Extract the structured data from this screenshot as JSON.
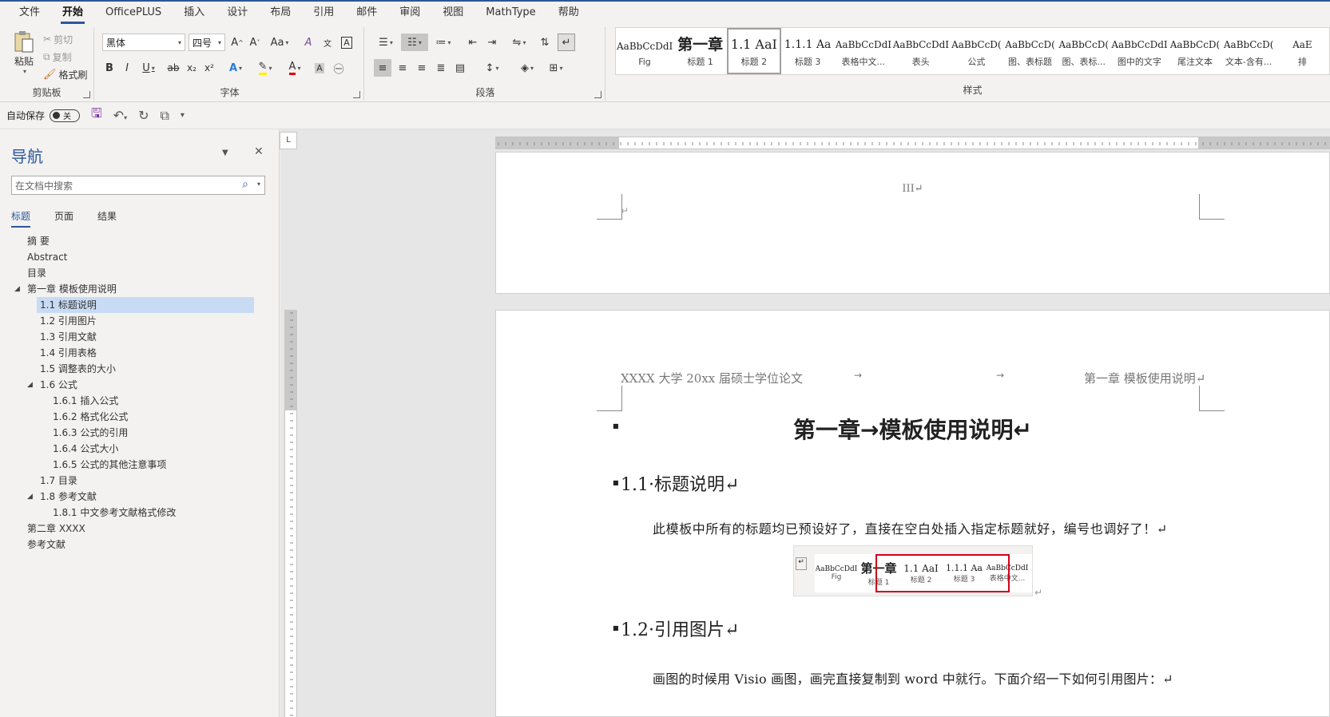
{
  "menu": {
    "tabs": [
      "文件",
      "开始",
      "OfficePLUS",
      "插入",
      "设计",
      "布局",
      "引用",
      "邮件",
      "审阅",
      "视图",
      "MathType",
      "帮助"
    ],
    "active": "开始"
  },
  "ribbon": {
    "clipboard": {
      "label": "剪贴板",
      "paste": "粘贴",
      "cut": "剪切",
      "copy": "复制",
      "format_painter": "格式刷"
    },
    "font": {
      "label": "字体",
      "font_name": "黑体",
      "font_size": "四号",
      "bold": "B",
      "italic": "I",
      "underline": "U",
      "strike": "ab",
      "sub": "x₂",
      "sup": "x²",
      "case": "Aa",
      "grow": "A^",
      "shrink": "A˅"
    },
    "paragraph": {
      "label": "段落"
    },
    "styles": {
      "label": "样式",
      "items": [
        {
          "preview": "AaBbCcDdI",
          "name": "Fig",
          "kind": "normal"
        },
        {
          "preview": "第一章",
          "name": "标题 1",
          "kind": "big"
        },
        {
          "preview": "1.1  AaI",
          "name": "标题 2",
          "kind": "mid",
          "selected": true
        },
        {
          "preview": "1.1.1  Aa",
          "name": "标题 3",
          "kind": "h3"
        },
        {
          "preview": "AaBbCcDdI",
          "name": "表格中文...",
          "kind": "normal"
        },
        {
          "preview": "AaBbCcDdI",
          "name": "表头",
          "kind": "normal"
        },
        {
          "preview": "AaBbCcD(",
          "name": "公式",
          "kind": "normal"
        },
        {
          "preview": "AaBbCcD(",
          "name": "图、表标题",
          "kind": "normal"
        },
        {
          "preview": "AaBbCcD(",
          "name": "图、表标...",
          "kind": "normal"
        },
        {
          "preview": "AaBbCcDdI",
          "name": "图中的文字",
          "kind": "normal"
        },
        {
          "preview": "AaBbCcD(",
          "name": "尾注文本",
          "kind": "normal"
        },
        {
          "preview": "AaBbCcD(",
          "name": "文本-含有...",
          "kind": "normal"
        },
        {
          "preview": "AaE",
          "name": "排",
          "kind": "normal"
        }
      ]
    }
  },
  "qat": {
    "autosave_label": "自动保存",
    "autosave_state": "关"
  },
  "nav": {
    "title": "导航",
    "search_placeholder": "在文档中搜索",
    "tabs": [
      "标题",
      "页面",
      "结果"
    ],
    "active_tab": "标题",
    "items": [
      {
        "text": "摘  要",
        "level": 0
      },
      {
        "text": "Abstract",
        "level": 0
      },
      {
        "text": "目录",
        "level": 0
      },
      {
        "text": "第一章  模板使用说明",
        "level": 0,
        "expanded": true
      },
      {
        "text": "1.1  标题说明",
        "level": 1,
        "selected": true
      },
      {
        "text": "1.2  引用图片",
        "level": 1
      },
      {
        "text": "1.3  引用文献",
        "level": 1
      },
      {
        "text": "1.4  引用表格",
        "level": 1
      },
      {
        "text": "1.5  调整表的大小",
        "level": 1
      },
      {
        "text": "1.6  公式",
        "level": 1,
        "expanded": true
      },
      {
        "text": "1.6.1  插入公式",
        "level": 2
      },
      {
        "text": "1.6.2  格式化公式",
        "level": 2
      },
      {
        "text": "1.6.3  公式的引用",
        "level": 2
      },
      {
        "text": "1.6.4  公式大小",
        "level": 2
      },
      {
        "text": "1.6.5  公式的其他注意事项",
        "level": 2
      },
      {
        "text": "1.7  目录",
        "level": 1
      },
      {
        "text": "1.8  参考文献",
        "level": 1,
        "expanded": true
      },
      {
        "text": "1.8.1  中文参考文献格式修改",
        "level": 2
      },
      {
        "text": "第二章  XXXX",
        "level": 0
      },
      {
        "text": "参考文献",
        "level": 0
      }
    ]
  },
  "document": {
    "page1_number": "III↵",
    "header_left": "XXXX 大学 20xx 届硕士学位论文",
    "header_right": "第一章 模板使用说明↵",
    "chapter_title": "第一章→模板使用说明↵",
    "h2_1": "1.1·标题说明↵",
    "para_1": "此模板中所有的标题均已预设好了，直接在空白处插入指定标题就好，编号也调好了！↵",
    "h2_2": "1.2·引用图片↵",
    "para_2": "画图的时候用 Visio 画图，画完直接复制到 word 中就行。下面介绍一下如何引用图片：↵",
    "inline_styles": [
      {
        "preview": "AaBbCcDdI",
        "name": "Fig"
      },
      {
        "preview": "第一章",
        "name": "标题 1"
      },
      {
        "preview": "1.1  AaI",
        "name": "标题 2"
      },
      {
        "preview": "1.1.1  Aa",
        "name": "标题 3"
      },
      {
        "preview": "AaBbCcDdI",
        "name": "表格中文..."
      }
    ]
  },
  "colors": {
    "accent": "#2b579a",
    "highlight": "#c7dcf4",
    "red_box": "#d0021b"
  }
}
